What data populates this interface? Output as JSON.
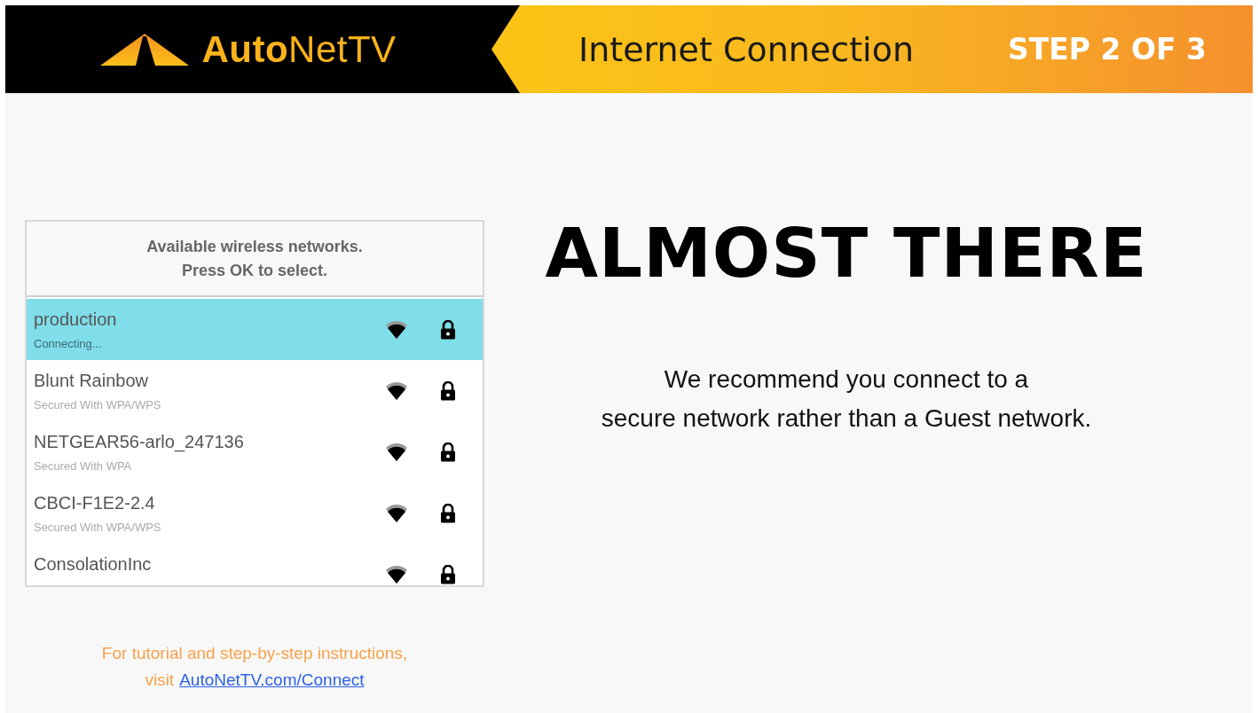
{
  "header": {
    "logo": "**Auto**NetTV",
    "title": "Internet Connection",
    "step": "STEP 2 OF 3"
  },
  "network_list": {
    "heading": [
      "Available wireless networks.",
      "Press OK to select."
    ],
    "networks": [
      {
        "name": "production",
        "status": "Connecting...",
        "selected": true,
        "secured": true
      },
      {
        "name": "Blunt Rainbow",
        "status": "Secured With WPA/WPS",
        "selected": false,
        "secured": true
      },
      {
        "name": "NETGEAR56-arlo_247136",
        "status": "Secured With WPA",
        "selected": false,
        "secured": true
      },
      {
        "name": "CBCI-F1E2-2.4",
        "status": "Secured With WPA/WPS",
        "selected": false,
        "secured": true
      },
      {
        "name": "ConsolationInc",
        "selected": false,
        "secured": true
      }
    ]
  },
  "help": {
    "text": "For tutorial and step-by-step instructions,",
    "prefix": "visit",
    "link": "AutoNetTV.com/Connect"
  },
  "headline": "ALMOST THERE",
  "message": [
    "We recommend you connect to a",
    "secure network rather than a Guest network."
  ]
}
